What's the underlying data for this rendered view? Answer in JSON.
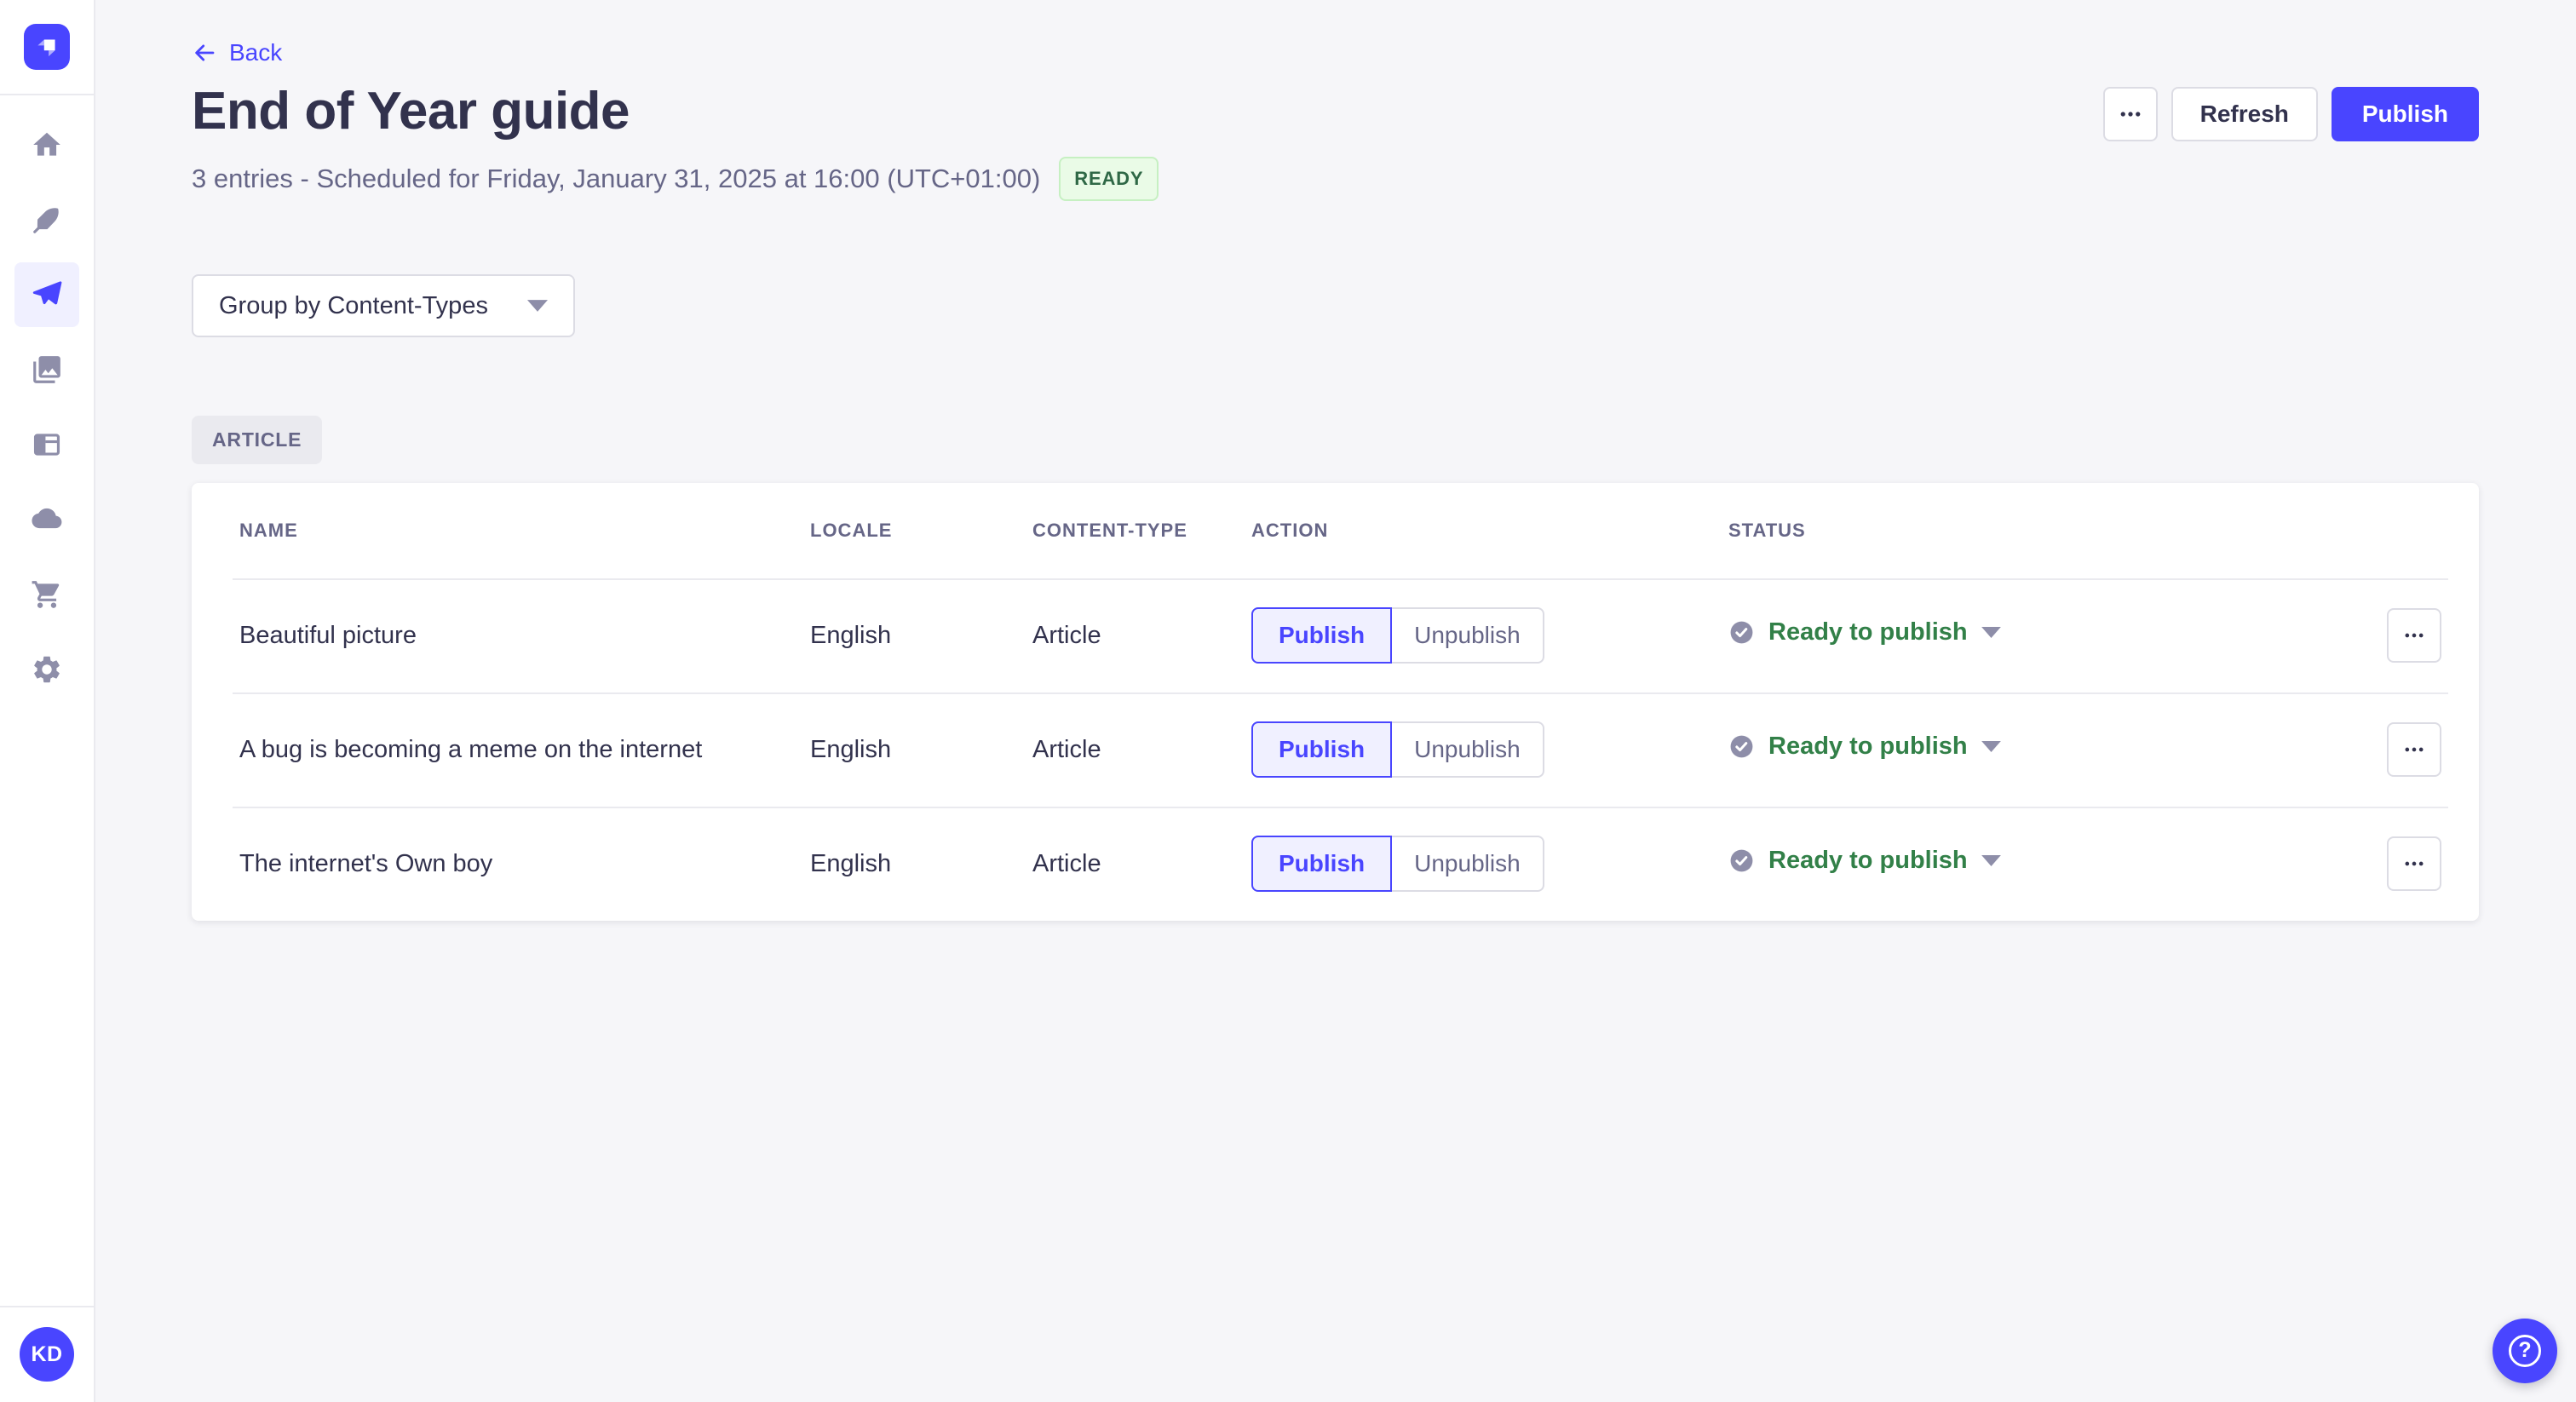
{
  "sidebar": {
    "logo_icon": "strapi-logo",
    "items": [
      {
        "name": "home",
        "icon": "home-icon",
        "active": false
      },
      {
        "name": "content-manager",
        "icon": "feather-icon",
        "active": false
      },
      {
        "name": "releases",
        "icon": "paper-plane-icon",
        "active": true
      },
      {
        "name": "media-library",
        "icon": "photos-icon",
        "active": false
      },
      {
        "name": "content-type-builder",
        "icon": "layout-icon",
        "active": false
      },
      {
        "name": "cloud",
        "icon": "cloud-icon",
        "active": false
      },
      {
        "name": "marketplace",
        "icon": "cart-icon",
        "active": false
      },
      {
        "name": "settings",
        "icon": "gear-icon",
        "active": false
      }
    ],
    "avatar_initials": "KD"
  },
  "header": {
    "back_label": "Back",
    "title": "End of Year guide",
    "subtitle": "3 entries - Scheduled for Friday, January 31, 2025 at 16:00 (UTC+01:00)",
    "status_badge": "READY",
    "more_icon": "ellipsis-icon",
    "refresh_label": "Refresh",
    "publish_label": "Publish"
  },
  "toolbar": {
    "group_by_label": "Group by Content-Types",
    "caret_icon": "chevron-down-icon"
  },
  "section": {
    "group_label": "ARTICLE"
  },
  "table": {
    "headers": [
      "NAME",
      "LOCALE",
      "CONTENT-TYPE",
      "ACTION",
      "STATUS"
    ],
    "rows": [
      {
        "name": "Beautiful picture",
        "locale": "English",
        "content_type": "Article",
        "publish_label": "Publish",
        "unpublish_label": "Unpublish",
        "status": "Ready to publish",
        "status_icon": "check-circle-icon"
      },
      {
        "name": "A bug is becoming a meme on the internet",
        "locale": "English",
        "content_type": "Article",
        "publish_label": "Publish",
        "unpublish_label": "Unpublish",
        "status": "Ready to publish",
        "status_icon": "check-circle-icon"
      },
      {
        "name": "The internet's Own boy",
        "locale": "English",
        "content_type": "Article",
        "publish_label": "Publish",
        "unpublish_label": "Unpublish",
        "status": "Ready to publish",
        "status_icon": "check-circle-icon"
      }
    ]
  },
  "fab": {
    "help_icon": "question-circle-icon"
  },
  "colors": {
    "primary": "#4945FF",
    "primary_light": "#F0F0FF",
    "success_text": "#328048",
    "success_badge_text": "#2F6846",
    "success_bg": "#EAFBE7",
    "success_border": "#C6F0C2",
    "neutral_border": "#DCDCE4",
    "divider": "#EAEAEF",
    "text_dark": "#32324D",
    "text_muted": "#666687",
    "icon_gray": "#8E8EA9",
    "page_bg": "#F6F6F9"
  }
}
